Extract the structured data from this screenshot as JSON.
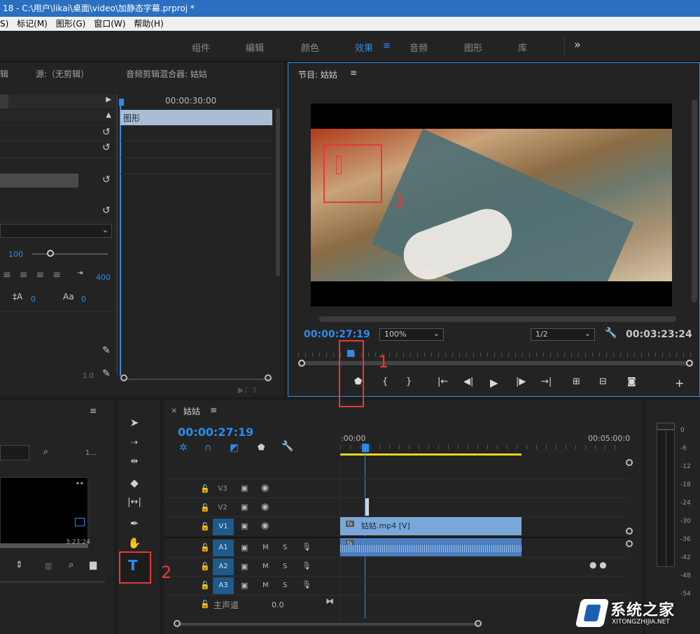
{
  "titlebar": {
    "text": "18 - C:\\用户\\likai\\桌面\\video\\加静态字幕.prproj *"
  },
  "menubar": {
    "items": [
      "S)",
      "标记(M)",
      "图形(G)",
      "窗口(W)",
      "帮助(H)"
    ]
  },
  "workspaces": {
    "tabs": [
      "组件",
      "编辑",
      "颜色",
      "效果",
      "音频",
      "图形",
      "库"
    ],
    "active": "效果",
    "more": "»"
  },
  "source_panel": {
    "tab_partial": "辑",
    "source_tab": "源:（无剪辑）",
    "audio_mixer_tab": "音频剪辑混合器: 姑姑",
    "timecode": "00:00:30:00",
    "clip_label": "图形",
    "value_100": "100",
    "value_400": "400",
    "value_0a": "0",
    "value_0b": "0",
    "value_1_0": "1.0"
  },
  "program_monitor": {
    "title": "节目: 姑姑",
    "timecode": "00:00:27:19",
    "zoom": "100%",
    "resolution": "1/2",
    "duration": "00:03:23:24"
  },
  "project_panel": {
    "page_partial": "1...",
    "thumb_time": "3:23:24"
  },
  "timeline": {
    "sequence_name": "姑姑",
    "timecode": "00:00:27:19",
    "ruler_start": ":00:00",
    "ruler_mark": "00:05:00:0",
    "tracks": [
      {
        "id": "V3",
        "type": "video"
      },
      {
        "id": "V2",
        "type": "video"
      },
      {
        "id": "V1",
        "type": "video",
        "source_label": "V1"
      },
      {
        "id": "A1",
        "type": "audio",
        "source_label": "A1"
      },
      {
        "id": "A2",
        "type": "audio",
        "source_label": "A2"
      },
      {
        "id": "A3",
        "type": "audio",
        "source_label": "A3"
      }
    ],
    "mute": "M",
    "solo": "S",
    "master_label": "主声道",
    "master_value": "0.0",
    "video_clip": "姑姑.mp4 [V]",
    "fx": "fx"
  },
  "audio_meter": {
    "labels": [
      "0",
      "-6",
      "-12",
      "-18",
      "-24",
      "-30",
      "-36",
      "-42",
      "-48",
      "-54"
    ]
  },
  "annotations": {
    "n1": "1",
    "n2": "2",
    "n3": "3"
  },
  "watermark": {
    "brand": "系统之家",
    "url": "XITONGZHIJIA.NET"
  },
  "colors": {
    "accent": "#2d8ceb",
    "annotation": "#e53935",
    "clip": "#7aa8d8",
    "titlebar": "#2a6fc0"
  }
}
